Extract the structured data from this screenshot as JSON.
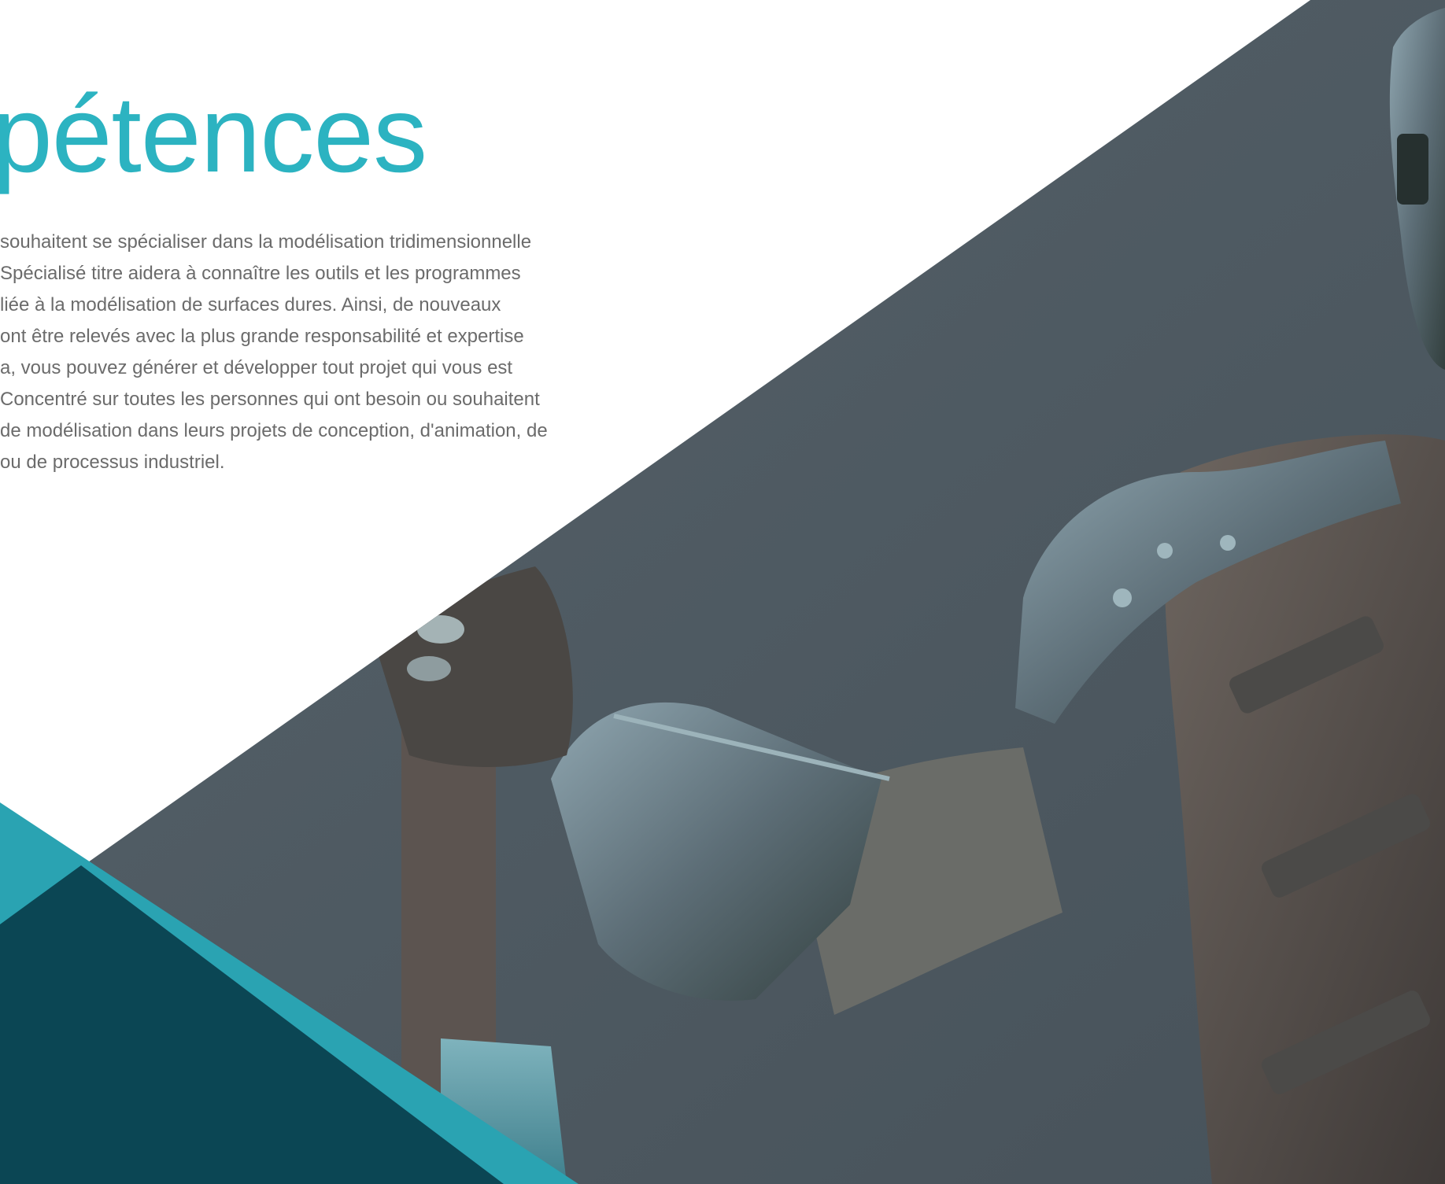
{
  "heading": "pétences",
  "description_lines": [
    "souhaitent se spécialiser dans la modélisation tridimensionnelle",
    "Spécialisé titre aidera à connaître les outils et les programmes",
    " liée à la modélisation de surfaces dures. Ainsi, de nouveaux",
    "ont être relevés avec la plus grande responsabilité et expertise",
    "a, vous pouvez générer et développer tout projet qui vous est",
    " Concentré sur toutes les personnes qui ont besoin ou souhaitent",
    "de modélisation dans leurs projets de conception, d'animation, de",
    "ou de processus industriel."
  ],
  "colors": {
    "accent": "#2cb3c1",
    "text": "#6b6b6b",
    "image_background": "#4f5b62",
    "teal_light": "#2aa3b2",
    "teal_dark": "#0b4654"
  },
  "image": {
    "subject": "armored-knight-3d-model"
  }
}
